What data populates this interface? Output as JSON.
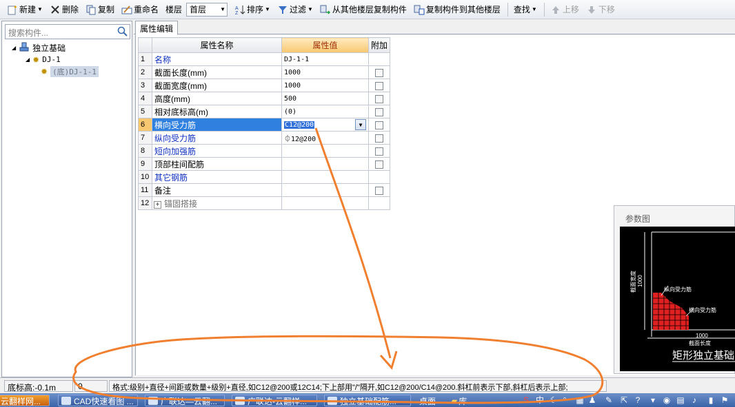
{
  "toolbar": {
    "new_label": "新建",
    "delete_label": "删除",
    "copy_label": "复制",
    "rename_label": "重命名",
    "floor_label": "楼层",
    "floor_value": "首层",
    "sort_label": "排序",
    "filter_label": "过滤",
    "copy_from_label": "从其他楼层复制构件",
    "copy_to_label": "复制构件到其他楼层",
    "find_label": "查找",
    "up_label": "上移",
    "down_label": "下移"
  },
  "sidebar": {
    "search_placeholder": "搜索构件...",
    "tree": [
      {
        "label": "独立基础"
      },
      {
        "label": "DJ-1"
      },
      {
        "label": "(底)DJ-1-1"
      }
    ]
  },
  "tab": {
    "label": "属性编辑"
  },
  "grid": {
    "headers": {
      "name": "属性名称",
      "value": "属性值",
      "add": "附加"
    },
    "rows": [
      {
        "num": "1",
        "name": "名称",
        "value": "DJ-1-1"
      },
      {
        "num": "2",
        "name": "截面长度(mm)",
        "value": "1000"
      },
      {
        "num": "3",
        "name": "截面宽度(mm)",
        "value": "1000"
      },
      {
        "num": "4",
        "name": "高度(mm)",
        "value": "500"
      },
      {
        "num": "5",
        "name": "相对底标高(m)",
        "value": "(0)"
      },
      {
        "num": "6",
        "name": "横向受力筋",
        "value": "C12@200"
      },
      {
        "num": "7",
        "name": "纵向受力筋",
        "value": "⏀12@200"
      },
      {
        "num": "8",
        "name": "短向加强筋",
        "value": ""
      },
      {
        "num": "9",
        "name": "顶部柱间配筋",
        "value": ""
      },
      {
        "num": "10",
        "name": "其它钢筋",
        "value": ""
      },
      {
        "num": "11",
        "name": "备注",
        "value": ""
      },
      {
        "num": "12",
        "name": "锚固搭接",
        "value": ""
      }
    ]
  },
  "param": {
    "title": "参数图",
    "dim_width": "截面宽度",
    "dim_width_value": "1000",
    "label_vertical": "纵向受力筋",
    "label_horizontal": "横向受力筋",
    "dim_length_value": "1000",
    "dim_length": "截面长度",
    "caption": "矩形独立基础"
  },
  "status": {
    "elevation": "底标高:-0.1m",
    "value": "0",
    "hint": "格式:级别+直径+间距或数量+级别+直径,如C12@200或12C14;下上部用\"/\"隔开,如C12@200/C14@200.斜杠前表示下部,斜杠后表示上部;"
  },
  "taskbar": {
    "items": [
      {
        "label": "云翻样网..."
      },
      {
        "label": "CAD快速看图 ..."
      },
      {
        "label": "广联达—云翻..."
      },
      {
        "label": "广联达-云翻样..."
      },
      {
        "label": "独立基础配筋..."
      }
    ],
    "desktop_label": "桌面",
    "library_label": "库",
    "ime_label": "中"
  },
  "colors": {
    "selection_blue": "#3080e0",
    "header_highlight": "#f8c870",
    "annotation_orange": "#f08030",
    "rebar_red": "#e02020"
  }
}
